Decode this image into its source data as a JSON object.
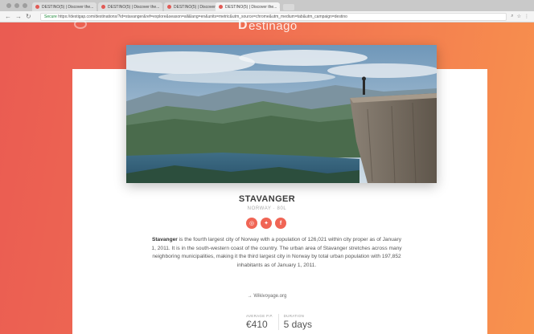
{
  "browser": {
    "tabs": [
      {
        "title": "DESTINO(5) | Discover the..."
      },
      {
        "title": "DESTINO(5) | Discover the..."
      },
      {
        "title": "DESTINO(5) | Discover the..."
      },
      {
        "title": "DESTINO(5) | Discover the..."
      }
    ],
    "secure_label": "Secure",
    "url": "https://destigap.com/destinations/?id=stavanger&ref=explore&season=all&lang=en&units=metric&utm_source=chrome&utm_medium=tab&utm_campaign=destino"
  },
  "site": {
    "logo_text": "estinago",
    "logo_mark": "D"
  },
  "destination": {
    "name": "STAVANGER",
    "subtitle": "NORWAY · 80L",
    "description_bold": "Stavanger",
    "description": " is the fourth largest city of Norway with a population of 126,021 within city proper as of January 1, 2011. It is in the south-western coast of the country. The urban area of Stavanger stretches across many neighboring municipalities, making it the third largest city in Norway by total urban population with 197,852 inhabitants as of January 1, 2011.",
    "link_arrow": "→",
    "link_text": "Wikivoyage.org",
    "stats": [
      {
        "label": "AVERAGE P.P.",
        "value": "€410"
      },
      {
        "label": "DURATION",
        "value": "5 days"
      }
    ]
  },
  "socials": [
    {
      "icon": "instagram-icon",
      "glyph": "◎"
    },
    {
      "icon": "twitter-icon",
      "glyph": "✦"
    },
    {
      "icon": "facebook-icon",
      "glyph": "f"
    }
  ]
}
